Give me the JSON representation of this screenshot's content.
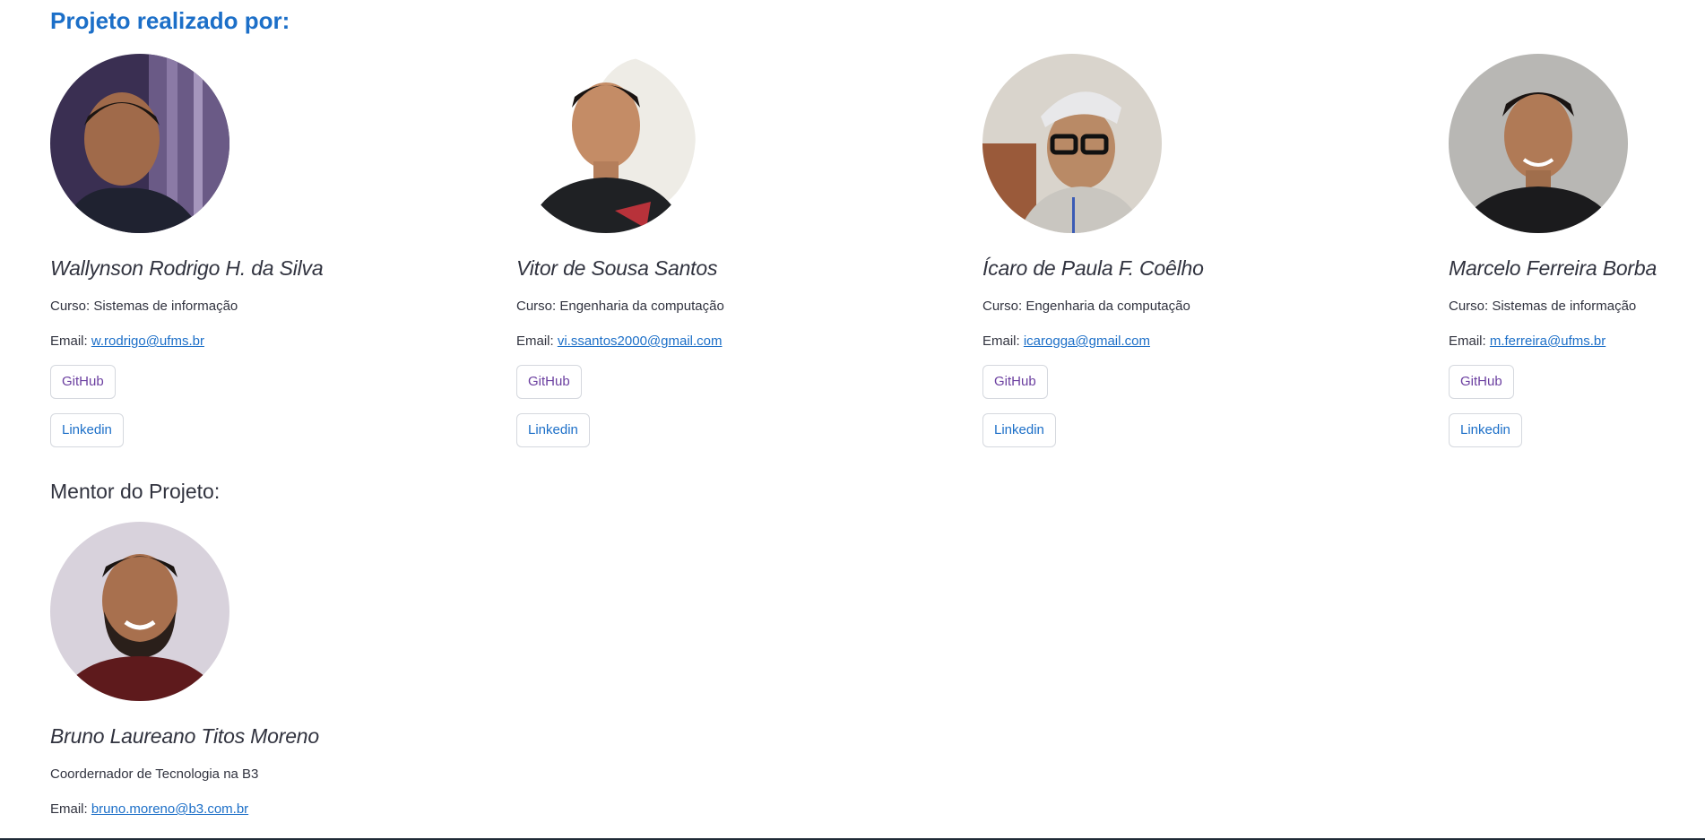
{
  "sections": {
    "team_title": "Projeto realizado por:",
    "mentor_title": "Mentor do Projeto:"
  },
  "members": [
    {
      "name": "Wallynson Rodrigo H. da Silva",
      "course": "Curso: Sistemas de informação",
      "email_label": "Email: ",
      "email": "w.rodrigo@ufms.br",
      "github": "GitHub",
      "linkedin": "Linkedin"
    },
    {
      "name": "Vitor de Sousa Santos",
      "course": "Curso: Engenharia da computação",
      "email_label": "Email: ",
      "email": "vi.ssantos2000@gmail.com",
      "github": "GitHub",
      "linkedin": "Linkedin"
    },
    {
      "name": "Ícaro de Paula F. Coêlho",
      "course": "Curso: Engenharia da computação",
      "email_label": "Email: ",
      "email": "icarogga@gmail.com",
      "github": "GitHub",
      "linkedin": "Linkedin"
    },
    {
      "name": "Marcelo Ferreira Borba",
      "course": "Curso: Sistemas de informação",
      "email_label": "Email: ",
      "email": "m.ferreira@ufms.br",
      "github": "GitHub",
      "linkedin": "Linkedin"
    }
  ],
  "mentor": {
    "name": "Bruno Laureano Titos Moreno",
    "role": "Coordernador de Tecnologia na B3",
    "email_label": "Email: ",
    "email": "bruno.moreno@b3.com.br"
  },
  "colors": {
    "accent": "#1c6fc8",
    "text": "#31333f",
    "github_text": "#6b3fa0"
  }
}
